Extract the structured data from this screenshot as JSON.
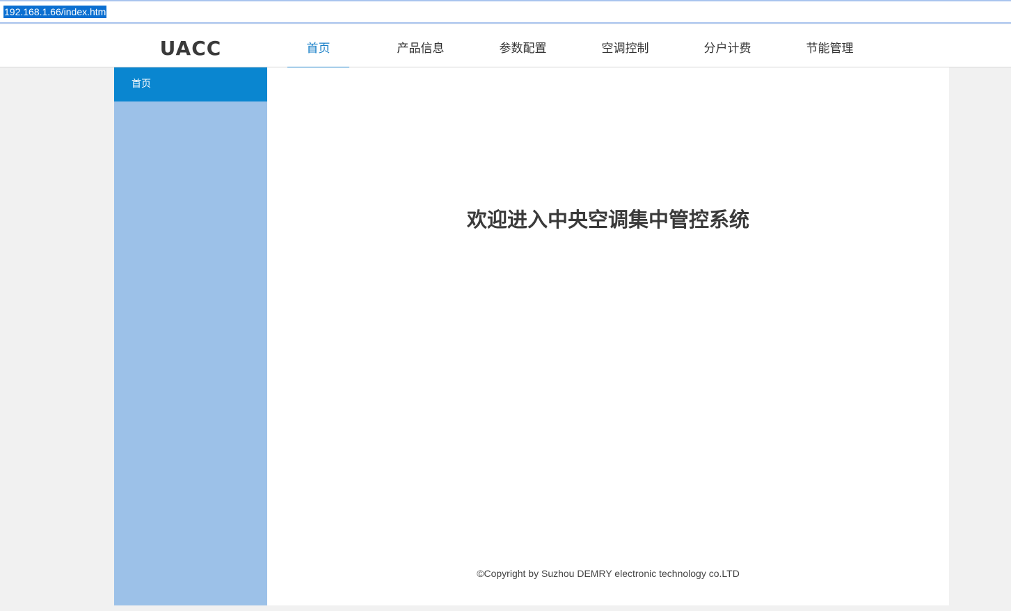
{
  "browser": {
    "url": "192.168.1.66/index.htm"
  },
  "header": {
    "logo": "UACC",
    "nav": [
      {
        "label": "首页",
        "active": true
      },
      {
        "label": "产品信息",
        "active": false
      },
      {
        "label": "参数配置",
        "active": false
      },
      {
        "label": "空调控制",
        "active": false
      },
      {
        "label": "分户计费",
        "active": false
      },
      {
        "label": "节能管理",
        "active": false
      }
    ]
  },
  "sidebar": {
    "items": [
      {
        "label": "首页",
        "active": true
      }
    ]
  },
  "main": {
    "welcome": "欢迎进入中央空调集中管控系统",
    "footer": "©Copyright by Suzhou DEMRY electronic technology co.LTD"
  },
  "colors": {
    "accent": "#1a80c8",
    "sidebar_bg": "#9cc1e8",
    "sidebar_active": "#0a86d0"
  }
}
